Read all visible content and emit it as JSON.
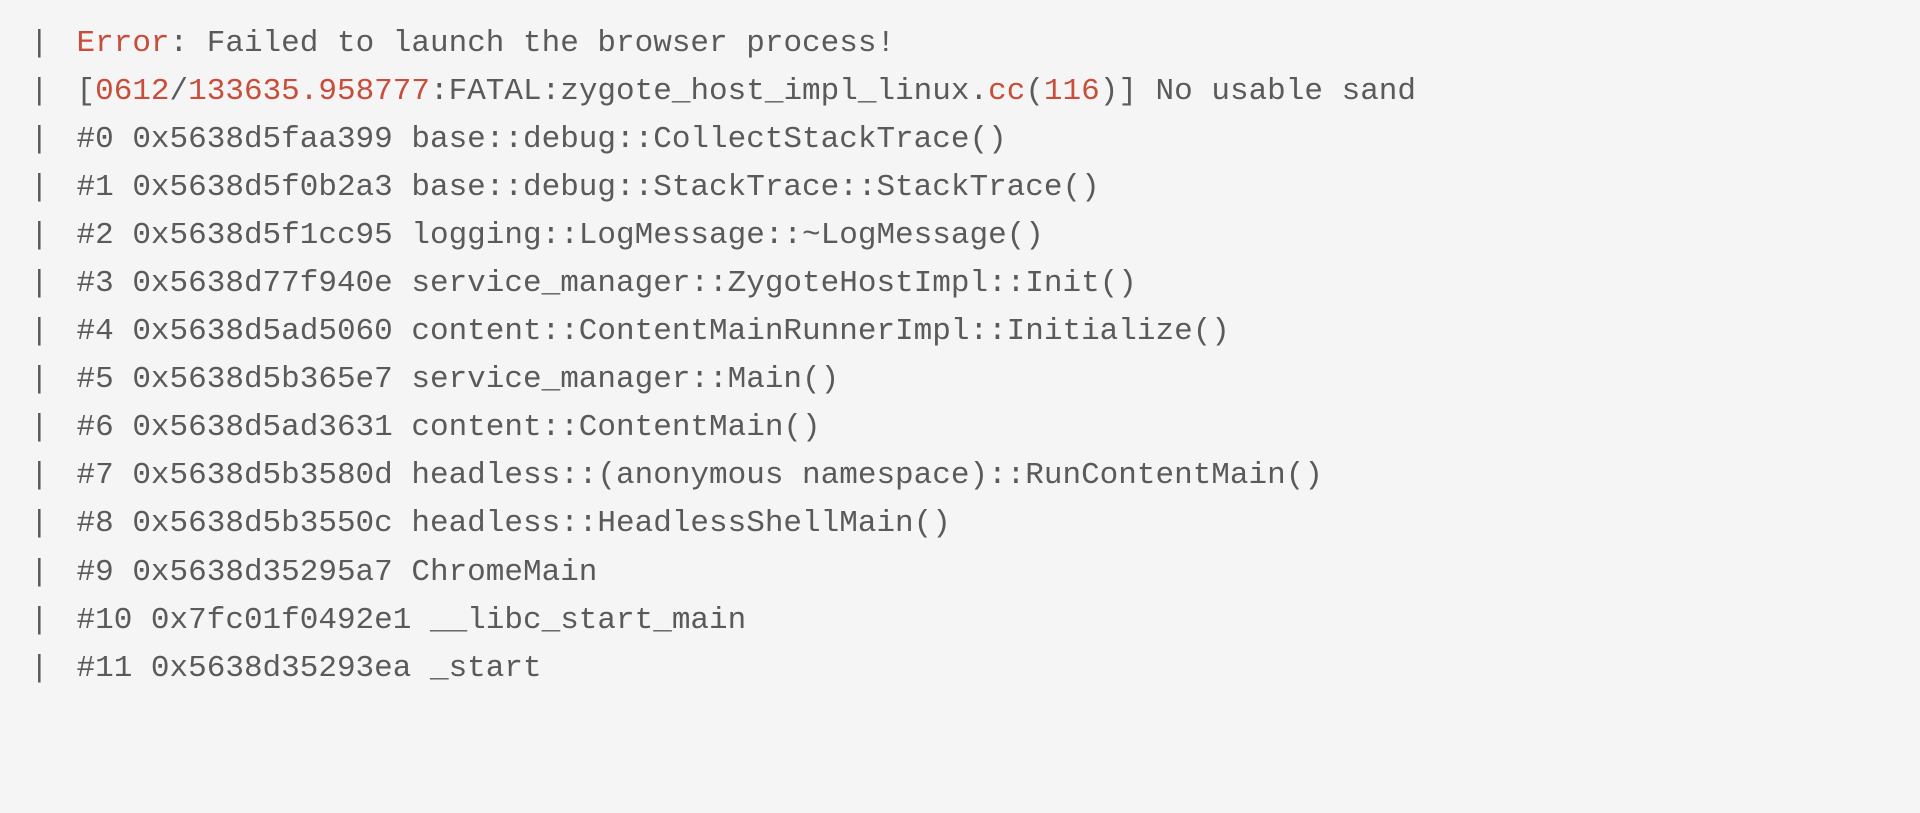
{
  "pipe": "|",
  "error_line": {
    "label": "Error",
    "sep": ": ",
    "message": "Failed to launch the browser process!"
  },
  "fatal_line": {
    "lbracket": "[",
    "ts1": "0612",
    "slash": "/",
    "ts2": "133635.958777",
    "middle": ":FATAL:zygote_host_impl_linux.",
    "cc": "cc",
    "lparen": "(",
    "linenum": "116",
    "rparen": ")",
    "rbracket": "]",
    "tail": " No usable sand"
  },
  "frames": [
    "#0 0x5638d5faa399 base::debug::CollectStackTrace()",
    "#1 0x5638d5f0b2a3 base::debug::StackTrace::StackTrace()",
    "#2 0x5638d5f1cc95 logging::LogMessage::~LogMessage()",
    "#3 0x5638d77f940e service_manager::ZygoteHostImpl::Init()",
    "#4 0x5638d5ad5060 content::ContentMainRunnerImpl::Initialize()",
    "#5 0x5638d5b365e7 service_manager::Main()",
    "#6 0x5638d5ad3631 content::ContentMain()",
    "#7 0x5638d5b3580d headless::(anonymous namespace)::RunContentMain()",
    "#8 0x5638d5b3550c headless::HeadlessShellMain()",
    "#9 0x5638d35295a7 ChromeMain",
    "#10 0x7fc01f0492e1 __libc_start_main",
    "#11 0x5638d35293ea _start"
  ]
}
